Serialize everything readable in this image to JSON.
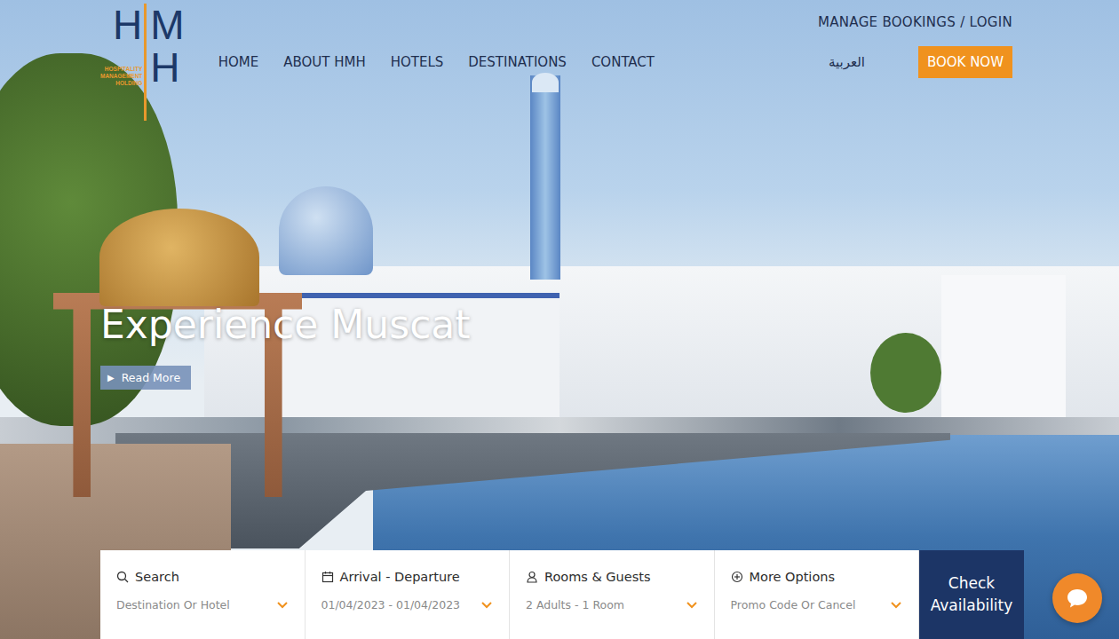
{
  "logo": {
    "letters": [
      "H",
      "M",
      "H"
    ],
    "tagline": [
      "HOSPITALITY",
      "MANAGEMENT",
      "HOLDING"
    ]
  },
  "top_link": "MANAGE BOOKINGS / LOGIN",
  "nav": [
    {
      "label": "HOME"
    },
    {
      "label": "ABOUT HMH"
    },
    {
      "label": "HOTELS"
    },
    {
      "label": "DESTINATIONS"
    },
    {
      "label": "CONTACT"
    }
  ],
  "language": "العربية",
  "book_now": "BOOK NOW",
  "hero": {
    "title": "Experience Muscat",
    "read_more": {
      "icon": "▶",
      "label": "Read More"
    }
  },
  "booking_bar": {
    "fields": [
      {
        "kind": "search",
        "label": "Search",
        "value": "Destination Or Hotel"
      },
      {
        "kind": "dates",
        "label": "Arrival - Departure",
        "value": "01/04/2023 - 01/04/2023"
      },
      {
        "kind": "guests",
        "label": "Rooms & Guests",
        "value": "2 Adults - 1 Room"
      },
      {
        "kind": "options",
        "label": "More Options",
        "value": "Promo Code Or Cancel"
      }
    ],
    "submit": "Check Availability"
  }
}
